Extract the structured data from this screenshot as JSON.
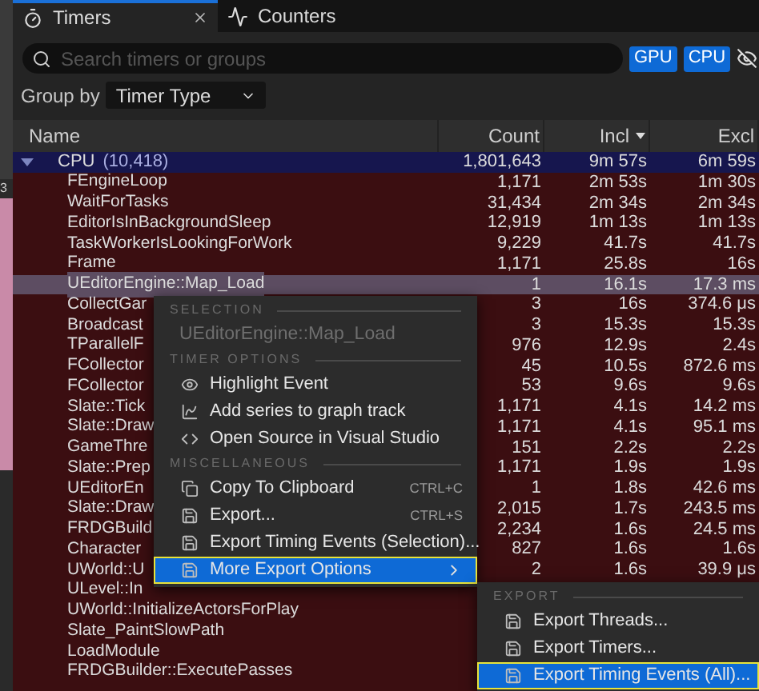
{
  "side_strip": {
    "label": "3"
  },
  "tabs": [
    {
      "label": "Timers",
      "kind": "timers",
      "selected": true
    },
    {
      "label": "Counters",
      "kind": "counters",
      "selected": false
    }
  ],
  "search": {
    "placeholder": "Search timers or groups"
  },
  "filters": [
    {
      "label": "GPU",
      "on": true
    },
    {
      "label": "CPU",
      "on": true
    }
  ],
  "group_by": {
    "label": "Group by",
    "value": "Timer Type"
  },
  "table": {
    "columns": [
      {
        "label": "Name",
        "sorted": false
      },
      {
        "label": "Count",
        "sorted": false
      },
      {
        "label": "Incl",
        "sorted": true
      },
      {
        "label": "Excl",
        "sorted": false
      }
    ],
    "groups": [
      {
        "name": "CPU",
        "badge": "(10,418)",
        "count": "1,801,643",
        "incl": "9m 57s",
        "excl": "6m 59s",
        "expanded": true,
        "children": [
          {
            "name": "FEngineLoop",
            "count": "1,171",
            "incl": "2m 53s",
            "excl": "1m 30s",
            "selected": false
          },
          {
            "name": "WaitForTasks",
            "count": "31,434",
            "incl": "2m 34s",
            "excl": "2m 34s",
            "selected": false
          },
          {
            "name": "EditorIsInBackgroundSleep",
            "count": "12,919",
            "incl": "1m 13s",
            "excl": "1m 13s",
            "selected": false
          },
          {
            "name": "TaskWorkerIsLookingForWork",
            "count": "9,229",
            "incl": "41.7s",
            "excl": "41.7s",
            "selected": false
          },
          {
            "name": "Frame",
            "count": "1,171",
            "incl": "25.8s",
            "excl": "16s",
            "selected": false
          },
          {
            "name": "UEditorEngine::Map_Load",
            "count": "1",
            "incl": "16.1s",
            "excl": "17.3 ms",
            "selected": true
          },
          {
            "name": "CollectGar",
            "count": "3",
            "incl": "16s",
            "excl": "374.6 μs",
            "selected": false
          },
          {
            "name": "Broadcast",
            "count": "3",
            "incl": "15.3s",
            "excl": "15.3s",
            "selected": false
          },
          {
            "name": "TParallelF",
            "count": "976",
            "incl": "12.9s",
            "excl": "2.4s",
            "selected": false
          },
          {
            "name": "FCollector",
            "count": "45",
            "incl": "10.5s",
            "excl": "872.6 ms",
            "selected": false
          },
          {
            "name": "FCollector",
            "count": "53",
            "incl": "9.6s",
            "excl": "9.6s",
            "selected": false
          },
          {
            "name": "Slate::Tick",
            "count": "1,171",
            "incl": "4.1s",
            "excl": "14.2 ms",
            "selected": false
          },
          {
            "name": "Slate::Draw",
            "count": "1,171",
            "incl": "4.1s",
            "excl": "95.1 ms",
            "selected": false
          },
          {
            "name": "GameThre",
            "count": "151",
            "incl": "2.2s",
            "excl": "2.2s",
            "selected": false
          },
          {
            "name": "Slate::Prep",
            "count": "1,171",
            "incl": "1.9s",
            "excl": "1.9s",
            "selected": false
          },
          {
            "name": "UEditorEn",
            "count": "1",
            "incl": "1.8s",
            "excl": "42.6 ms",
            "selected": false
          },
          {
            "name": "Slate::Draw",
            "count": "2,015",
            "incl": "1.7s",
            "excl": "243.5 ms",
            "selected": false
          },
          {
            "name": "FRDGBuild",
            "count": "2,234",
            "incl": "1.6s",
            "excl": "24.5 ms",
            "selected": false
          },
          {
            "name": "Character",
            "count": "827",
            "incl": "1.6s",
            "excl": "1.6s",
            "selected": false
          },
          {
            "name": "UWorld::U",
            "count": "2",
            "incl": "1.6s",
            "excl": "39.9 μs",
            "selected": false
          },
          {
            "name": "ULevel::In",
            "selected": false
          },
          {
            "name": "UWorld::InitializeActorsForPlay",
            "selected": false
          },
          {
            "name": "Slate_PaintSlowPath",
            "selected": false
          },
          {
            "name": "LoadModule",
            "selected": false
          },
          {
            "name": "FRDGBuilder::ExecutePasses",
            "selected": false
          }
        ]
      }
    ]
  },
  "context_menu": {
    "sections": [
      {
        "title": "SELECTION",
        "items": [
          {
            "label": "UEditorEngine::Map_Load",
            "kind": "label",
            "disabled": true
          }
        ]
      },
      {
        "title": "TIMER OPTIONS",
        "items": [
          {
            "label": "Highlight Event",
            "kind": "eye",
            "disabled": false,
            "selected": false
          },
          {
            "label": "Add series to graph track",
            "kind": "chart",
            "disabled": false,
            "selected": false
          },
          {
            "label": "Open Source in Visual Studio",
            "kind": "code",
            "disabled": false,
            "selected": false
          }
        ]
      },
      {
        "title": "MISCELLANEOUS",
        "items": [
          {
            "label": "Copy To Clipboard",
            "kind": "copy",
            "shortcut": "CTRL+C",
            "disabled": false,
            "selected": false
          },
          {
            "label": "Export...",
            "kind": "save",
            "shortcut": "CTRL+S",
            "disabled": false,
            "selected": false
          },
          {
            "label": "Export Timing Events (Selection)...",
            "kind": "save",
            "disabled": false,
            "selected": false
          },
          {
            "label": "More Export Options",
            "kind": "save",
            "has_submenu": true,
            "disabled": false,
            "selected": true
          }
        ]
      }
    ]
  },
  "submenu": {
    "sections": [
      {
        "title": "EXPORT",
        "items": [
          {
            "label": "Export Threads...",
            "kind": "save",
            "disabled": false,
            "selected": false
          },
          {
            "label": "Export Timers...",
            "kind": "save",
            "disabled": false,
            "selected": false
          },
          {
            "label": "Export Timing Events (All)...",
            "kind": "save",
            "disabled": false,
            "selected": true
          }
        ]
      }
    ]
  }
}
